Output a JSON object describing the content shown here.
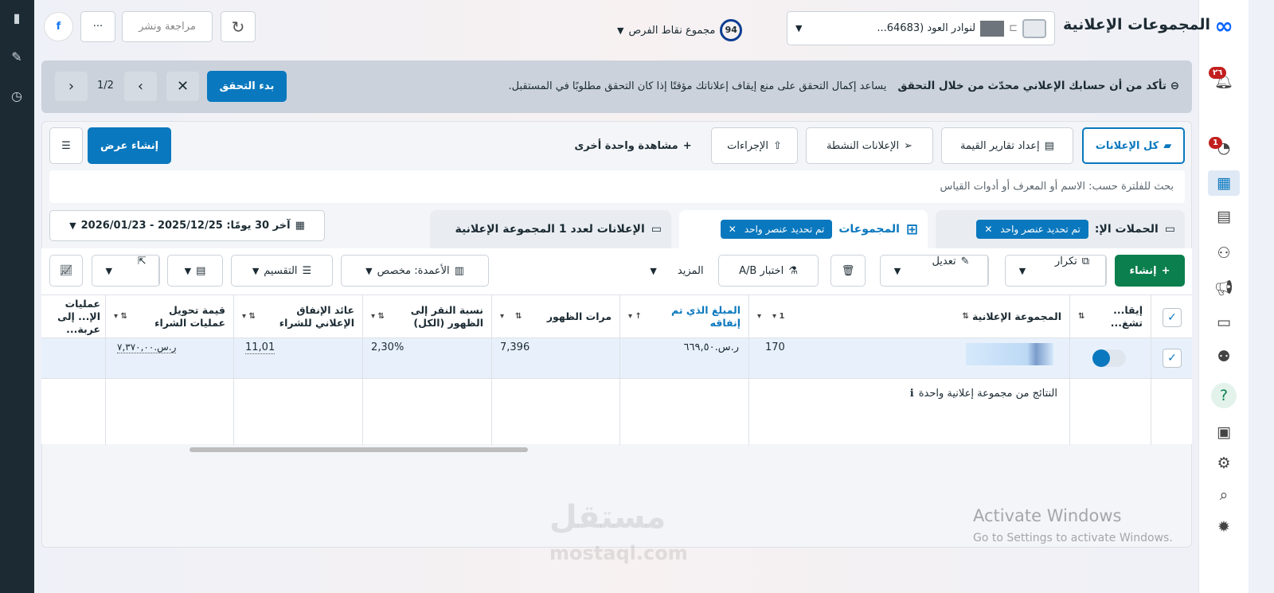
{
  "header": {
    "title": "المجموعات الإعلانية",
    "account": "لنوادر العود (64683...",
    "score": "94",
    "score_label": "مجموع نقاط الفرص",
    "review_publish": "مراجعة ونشر",
    "more": "···"
  },
  "banner": {
    "title": "تأكد من أن حسابك الإعلاني محدّث من خلال التحقق",
    "text": "يساعد إكمال التحقق على منع إيقاف إعلاناتك مؤقتًا إذا كان التحقق مطلوبًا في المستقبل.",
    "start": "بدء التحقق",
    "pager": "1/2"
  },
  "tabs": {
    "all_ads": "كل الإعلانات",
    "value_reports": "إعداد تقارير القيمة",
    "active_ads": "الإعلانات النشطة",
    "actions": "الإجراءات",
    "another_view": "مشاهدة واحدة أخرى",
    "create_view": "إنشاء عرض"
  },
  "search": {
    "placeholder": "بحث للفلترة حسب: الاسم أو المعرف أو أدوات القياس"
  },
  "levels": {
    "campaigns": "الحملات الإ:",
    "campaigns_chip": "تم تحديد عنصر واحد",
    "adsets": "المجموعات",
    "adsets_chip": "تم تحديد عنصر واحد",
    "ads": "الإعلانات لعدد 1 المجموعة الإعلانية"
  },
  "date_range": "آخر 30 يومًا: 2025/12/25 - 2026/01/23",
  "toolbar": {
    "create": "إنشاء",
    "duplicate": "تكرار",
    "edit": "تعديل",
    "ab_test": "اختبار A/B",
    "more": "المزيد",
    "columns": "الأعمدة: مخصص",
    "breakdown": "التقسيم"
  },
  "table": {
    "headers": {
      "status": "إيقا... تشغ...",
      "name": "المجموعة الإعلانية",
      "results": "1",
      "spent": "المبلغ الذي تم إنفاقه",
      "impressions": "مرات الظهور",
      "ctr": "نسبة النقر إلى الظهور (الكل)",
      "roas": "عائد الإنفاق الإعلاني للشراء",
      "conv_value": "قيمة تحويل عمليات الشراء",
      "add_cart": "عمليات الإ... إلى عربة..."
    },
    "row": {
      "results": "170",
      "spent": "ر.س.٦٦٩,٥٠",
      "impressions": "7,396",
      "ctr": "2,30%",
      "roas": "11,01",
      "conv_value": "ر.س.٧,٣٧٠,٠٠"
    },
    "summary": "النتائج من مجموعة إعلانية واحدة"
  },
  "rail": {
    "bell_badge": "٢٦",
    "gauge_badge": "1"
  },
  "watermark": {
    "title": "Activate Windows",
    "text": "Go to Settings to activate Windows.",
    "logo": "مستقل mostaql.com"
  },
  "colors": {
    "accent": "#0a78be",
    "create": "#0b7f4d"
  }
}
